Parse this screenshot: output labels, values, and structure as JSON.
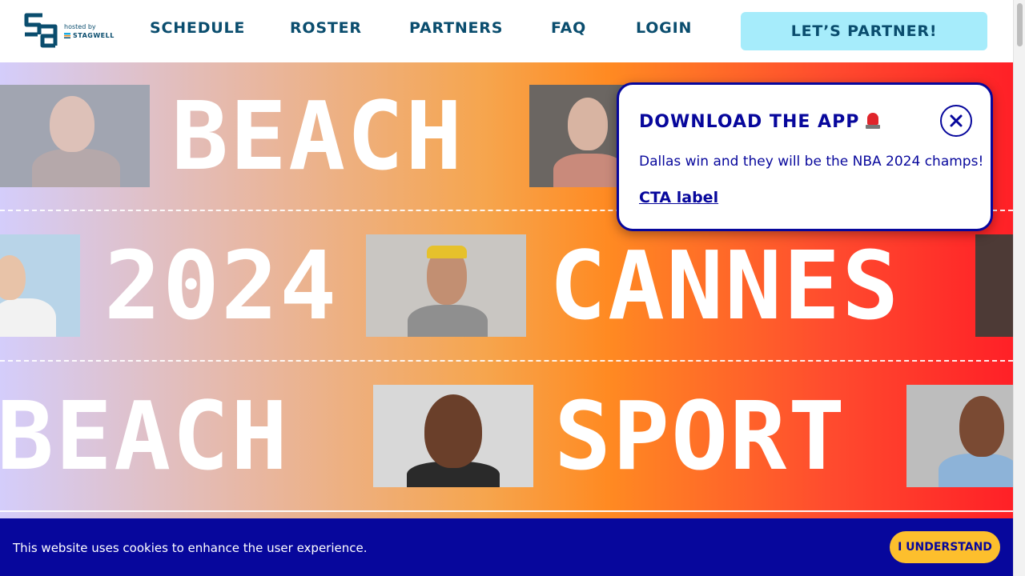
{
  "header": {
    "logo": {
      "hosted_text": "hosted by",
      "partner_text": "STAGWELL"
    },
    "nav": [
      {
        "label": "SCHEDULE"
      },
      {
        "label": "ROSTER"
      },
      {
        "label": "PARTNERS"
      },
      {
        "label": "FAQ"
      },
      {
        "label": "LOGIN"
      }
    ],
    "cta_label": "LET’S PARTNER!"
  },
  "hero": {
    "rows": [
      {
        "words": [
          "BEACH"
        ]
      },
      {
        "words": [
          "2024",
          "CANNES"
        ]
      },
      {
        "words": [
          "BEACH",
          "SPORT"
        ]
      }
    ]
  },
  "popup": {
    "title": "DOWNLOAD THE APP",
    "title_icon": "siren-icon",
    "body": "Dallas win and they will be the NBA 2024 champs!",
    "link_label": "CTA label"
  },
  "cookie_bar": {
    "message": "This website uses cookies to enhance the user experience.",
    "button_label": "I UNDERSTAND"
  },
  "colors": {
    "brand_navy": "#0a4d6e",
    "popup_blue": "#07079c",
    "cta_cyan": "#a6ecfb",
    "cookie_button": "#fdbf2d"
  }
}
